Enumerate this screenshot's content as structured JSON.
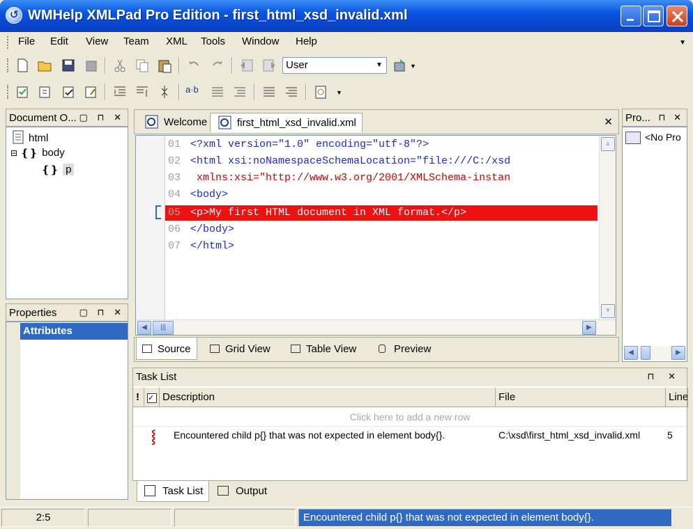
{
  "window": {
    "title": "WMHelp XMLPad Pro Edition - first_html_xsd_invalid.xml",
    "icons": [
      "app-icon",
      "minimize-icon",
      "maximize-icon",
      "close-icon"
    ]
  },
  "menu": {
    "items": [
      "File",
      "Edit",
      "View",
      "Team",
      "XML",
      "Tools",
      "Window",
      "Help"
    ]
  },
  "toolbar": {
    "combo_value": "User"
  },
  "document_outline": {
    "title": "Document O...",
    "tree": [
      {
        "label": "html",
        "icon": "document-icon"
      },
      {
        "label": "body",
        "icon": "element-icon"
      },
      {
        "label": "p",
        "icon": "element-icon"
      }
    ]
  },
  "properties_panel": {
    "title": "Properties",
    "header": "Attributes"
  },
  "right_panel": {
    "title": "Pro...",
    "item": "<No Pro"
  },
  "editor": {
    "tabs": [
      "Welcome",
      "first_html_xsd_invalid.xml"
    ],
    "active_tab": "first_html_xsd_invalid.xml",
    "lines": [
      {
        "num": "01",
        "text": "<?xml version=\"1.0\" encoding=\"utf-8\"?>",
        "style": "normal"
      },
      {
        "num": "02",
        "text": "<html xsi:noNamespaceSchemaLocation=\"file:///C:/xsd",
        "style": "normal"
      },
      {
        "num": "03",
        "text": " xmlns:xsi=\"http://www.w3.org/2001/XMLSchema-instan",
        "style": "red"
      },
      {
        "num": "04",
        "text": "<body>",
        "style": "normal"
      },
      {
        "num": "05",
        "text": "<p>My first HTML document in XML format.</p>",
        "style": "error"
      },
      {
        "num": "06",
        "text": "</body>",
        "style": "normal"
      },
      {
        "num": "07",
        "text": "</html>",
        "style": "normal"
      }
    ],
    "view_tabs": [
      "Source",
      "Grid View",
      "Table View",
      "Preview"
    ],
    "active_view": "Source"
  },
  "task_list": {
    "title": "Task List",
    "columns": [
      "!",
      "Description",
      "File",
      "Line"
    ],
    "add_row_hint": "Click here to add a new row",
    "rows": [
      {
        "description": "Encountered child p{} that was not expected in element body{}.",
        "file": "C:\\xsd\\first_html_xsd_invalid.xml",
        "line": "5"
      }
    ],
    "bottom_tabs": [
      "Task List",
      "Output"
    ],
    "active_tab": "Task List"
  },
  "status": {
    "position": "2:5",
    "message": "Encountered child p{} that was not expected in element body{}."
  },
  "colors": {
    "titlebar": "#0a55e2",
    "error_line": "#ee1111",
    "selection": "#316ac5"
  }
}
